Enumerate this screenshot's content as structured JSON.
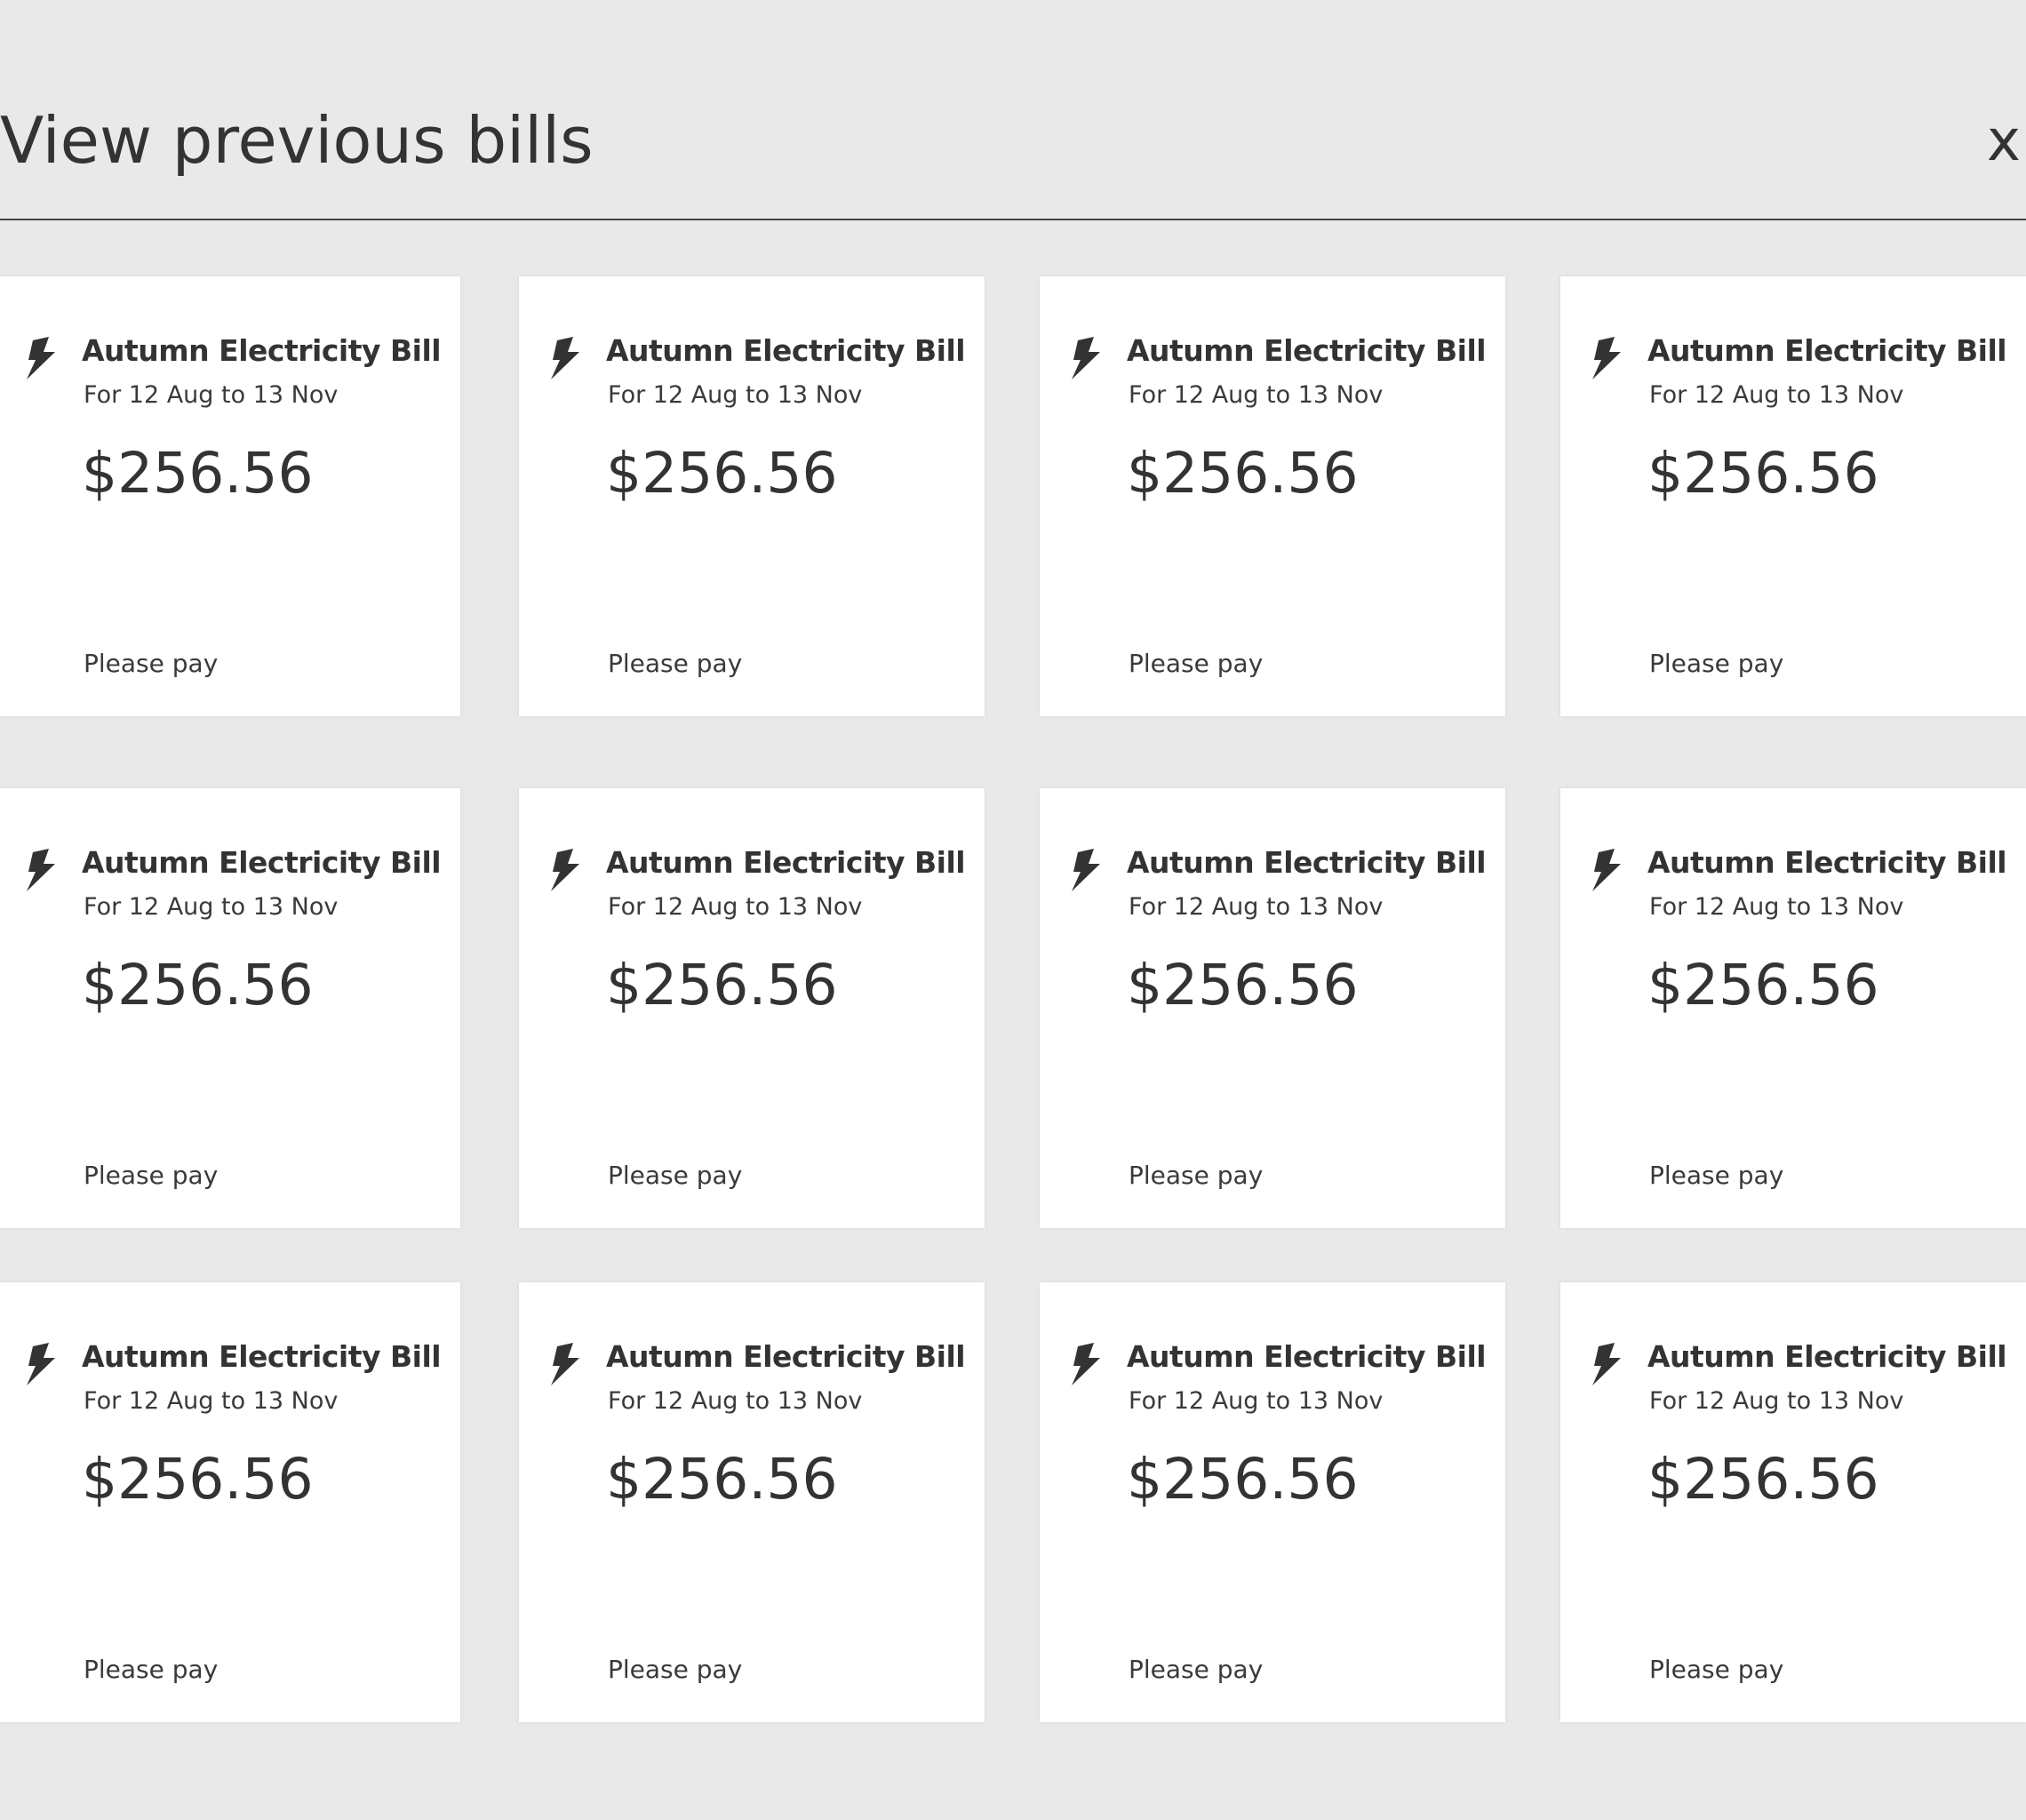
{
  "dialog": {
    "title": "View previous bills",
    "close_label": "x"
  },
  "bills": [
    {
      "icon": "lightning-bolt-icon",
      "title": "Autumn Electricity Bill",
      "period": "For 12 Aug to 13 Nov",
      "amount": "$256.56",
      "status": "Please pay"
    },
    {
      "icon": "lightning-bolt-icon",
      "title": "Autumn Electricity Bill",
      "period": "For 12 Aug to 13 Nov",
      "amount": "$256.56",
      "status": "Please pay"
    },
    {
      "icon": "lightning-bolt-icon",
      "title": "Autumn Electricity Bill",
      "period": "For 12 Aug to 13 Nov",
      "amount": "$256.56",
      "status": "Please pay"
    },
    {
      "icon": "lightning-bolt-icon",
      "title": "Autumn Electricity Bill",
      "period": "For 12 Aug to 13 Nov",
      "amount": "$256.56",
      "status": "Please pay"
    },
    {
      "icon": "lightning-bolt-icon",
      "title": "Autumn Electricity Bill",
      "period": "For 12 Aug to 13 Nov",
      "amount": "$256.56",
      "status": "Please pay"
    },
    {
      "icon": "lightning-bolt-icon",
      "title": "Autumn Electricity Bill",
      "period": "For 12 Aug to 13 Nov",
      "amount": "$256.56",
      "status": "Please pay"
    },
    {
      "icon": "lightning-bolt-icon",
      "title": "Autumn Electricity Bill",
      "period": "For 12 Aug to 13 Nov",
      "amount": "$256.56",
      "status": "Please pay"
    },
    {
      "icon": "lightning-bolt-icon",
      "title": "Autumn Electricity Bill",
      "period": "For 12 Aug to 13 Nov",
      "amount": "$256.56",
      "status": "Please pay"
    },
    {
      "icon": "lightning-bolt-icon",
      "title": "Autumn Electricity Bill",
      "period": "For 12 Aug to 13 Nov",
      "amount": "$256.56",
      "status": "Please pay"
    },
    {
      "icon": "lightning-bolt-icon",
      "title": "Autumn Electricity Bill",
      "period": "For 12 Aug to 13 Nov",
      "amount": "$256.56",
      "status": "Please pay"
    },
    {
      "icon": "lightning-bolt-icon",
      "title": "Autumn Electricity Bill",
      "period": "For 12 Aug to 13 Nov",
      "amount": "$256.56",
      "status": "Please pay"
    },
    {
      "icon": "lightning-bolt-icon",
      "title": "Autumn Electricity Bill",
      "period": "For 12 Aug to 13 Nov",
      "amount": "$256.56",
      "status": "Please pay"
    }
  ],
  "colors": {
    "background": "#e9e9e9",
    "card": "#ffffff",
    "text": "#333333"
  }
}
